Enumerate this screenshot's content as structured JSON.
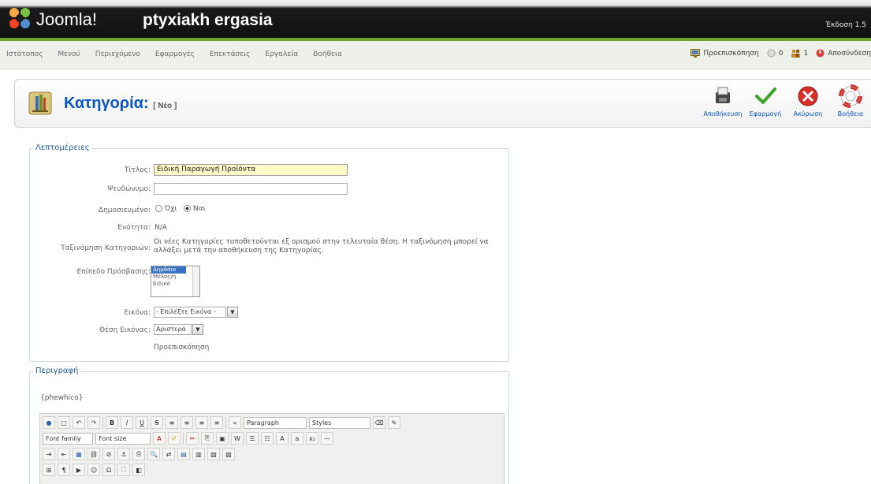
{
  "header": {
    "brand": "Joomla!",
    "site_name": "ptyxiakh ergasia",
    "version": "Έκδοση 1.5"
  },
  "menu": [
    "Ιστότοπος",
    "Μενού",
    "Περιεχόμενο",
    "Εφαρμογές",
    "Επεκτάσεις",
    "Εργαλεία",
    "Βοήθεια"
  ],
  "status": {
    "preview": "Προεπισκόπηση",
    "messages": "0",
    "users": "1",
    "logout": "Αποσύνδεση"
  },
  "title": {
    "main": "Κατηγορία:",
    "sub": "[ Νέο ]"
  },
  "toolbar": {
    "save": "Αποθήκευση",
    "apply": "Εφαρμογή",
    "cancel": "Ακύρωση",
    "help": "Βοήθεια"
  },
  "details": {
    "legend": "Λεπτομέρειες",
    "title_label": "Τίτλος:",
    "title_value": "Ειδική Παραγωγή Προϊόντα",
    "alias_label": "Ψευδώνυμο:",
    "alias_value": "",
    "published_label": "Δημοσιευμένο:",
    "published_no": "Όχι",
    "published_yes": "Ναι",
    "section_label": "Ενότητα:",
    "section_value": "N/A",
    "ordering_label": "Ταξινόμηση Κατηγοριών:",
    "ordering_text": "Οι νέες Κατηγορίες τοποθετούνται εξ ορισμού στην τελευταία θέση. Η ταξινόμηση μπορεί να αλλάξει μετά την αποθήκευση της Κατηγορίας.",
    "access_label": "Επίπεδο Πρόσβασης:",
    "access_options": [
      "Δημόσιο",
      "Μέλος/η",
      "Ειδικό"
    ],
    "image_label": "Εικόνα:",
    "image_value": "- Επιλέξτε Εικόνα -",
    "image_pos_label": "Θέση Εικόνας:",
    "image_pos_value": "Αριστερά",
    "preview_text": "Προεπισκόπηση"
  },
  "description": {
    "legend": "Περιγραφή",
    "placeholder_text": "{phewhico}",
    "format_select": "Paragraph",
    "styles_select": "Styles",
    "font_family": "Font family",
    "font_size": "Font size"
  }
}
